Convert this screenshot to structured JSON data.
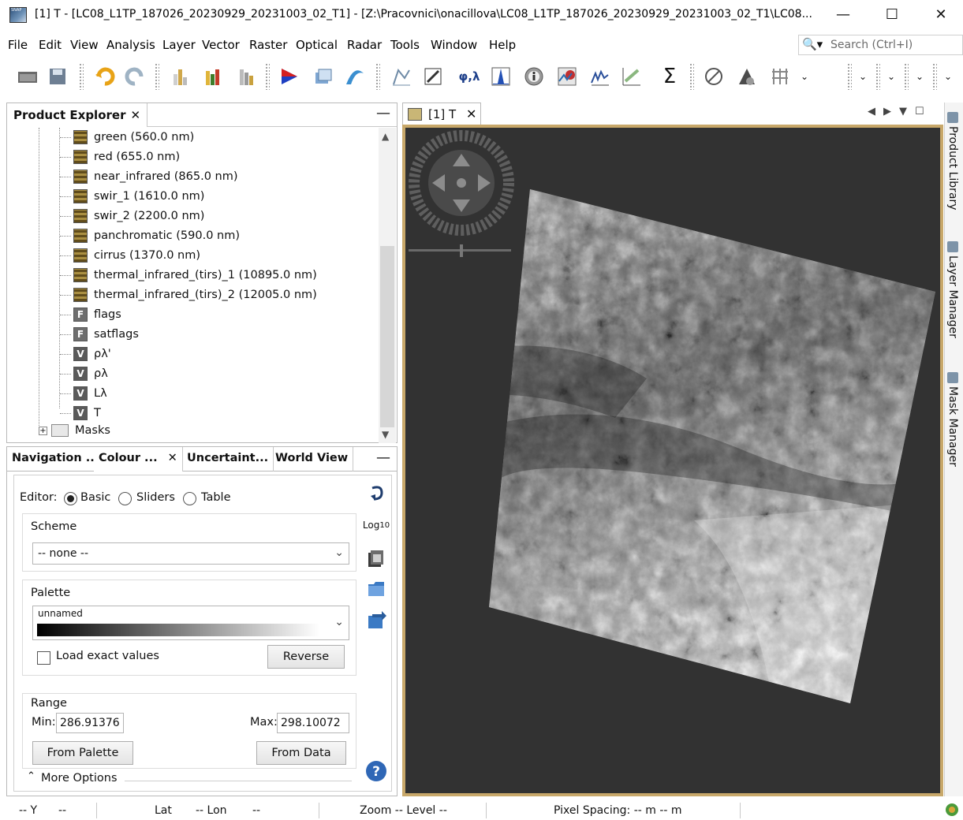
{
  "window": {
    "title": "[1] T - [LC08_L1TP_187026_20230929_20231003_02_T1] - [Z:\\Pracovnici\\onacillova\\LC08_L1TP_187026_20230929_20231003_02_T1\\LC08...",
    "minimize": "—",
    "maximize": "☐",
    "close": "✕"
  },
  "menu": [
    "File",
    "Edit",
    "View",
    "Analysis",
    "Layer",
    "Vector",
    "Raster",
    "Optical",
    "Radar",
    "Tools",
    "Window",
    "Help"
  ],
  "search": {
    "placeholder": "Search (Ctrl+I)",
    "icon": "search-icon"
  },
  "toolbar": {
    "phi_lambda": "φ,λ",
    "sigma": "Σ"
  },
  "product_explorer": {
    "title": "Product Explorer",
    "close": "✕",
    "minimize": "—",
    "nodes": [
      {
        "label": "green (560.0 nm)",
        "type": "band"
      },
      {
        "label": "red (655.0 nm)",
        "type": "band"
      },
      {
        "label": "near_infrared (865.0 nm)",
        "type": "band"
      },
      {
        "label": "swir_1 (1610.0 nm)",
        "type": "band"
      },
      {
        "label": "swir_2 (2200.0 nm)",
        "type": "band"
      },
      {
        "label": "panchromatic (590.0 nm)",
        "type": "band"
      },
      {
        "label": "cirrus (1370.0 nm)",
        "type": "band"
      },
      {
        "label": "thermal_infrared_(tirs)_1 (10895.0 nm)",
        "type": "band"
      },
      {
        "label": "thermal_infrared_(tirs)_2 (12005.0 nm)",
        "type": "band"
      },
      {
        "label": "flags",
        "type": "flag",
        "badge": "F"
      },
      {
        "label": "satflags",
        "type": "flag",
        "badge": "F"
      },
      {
        "label": "ρλ'",
        "type": "virtual",
        "badge": "V"
      },
      {
        "label": "ρλ",
        "type": "virtual",
        "badge": "V"
      },
      {
        "label": "Lλ",
        "type": "virtual",
        "badge": "V"
      },
      {
        "label": "T",
        "type": "virtual",
        "badge": "V"
      }
    ],
    "masks": "Masks",
    "expand": "+"
  },
  "tool_tabs": {
    "navigation": "Navigation ...",
    "colour": "Colour ...",
    "colour_close": "✕",
    "uncertainty": "Uncertaint...",
    "world_view": "World View",
    "minimize": "—"
  },
  "colour_manip": {
    "editor_label": "Editor:",
    "editor_options": [
      "Basic",
      "Sliders",
      "Table"
    ],
    "editor_selected": "Basic",
    "scheme_label": "Scheme",
    "scheme_value": "-- none --",
    "palette_label": "Palette",
    "palette_value": "unnamed",
    "load_exact": "Load exact values",
    "reverse": "Reverse",
    "range_label": "Range",
    "min_label": "Min:",
    "min_value": "286.91376",
    "max_label": "Max:",
    "max_value": "298.10072",
    "from_palette": "From Palette",
    "from_data": "From Data",
    "more_options": "More Options",
    "more_chevron": "⌃",
    "log_label": "Log",
    "log_sub": "10"
  },
  "image_view": {
    "tab_label": "[1] T",
    "tab_close": "✕"
  },
  "right_panel": {
    "tabs": [
      "Product Library",
      "Layer Manager",
      "Mask Manager"
    ]
  },
  "status": {
    "y": "-- Y",
    "y_val": "--",
    "lat": "Lat",
    "lon": "-- Lon",
    "lon_val": "--",
    "zoom": "Zoom -- Level --",
    "pixel_spacing": "Pixel Spacing: -- m -- m"
  },
  "colors": {
    "view_background": "#323232",
    "view_border": "#c8a86a",
    "accent": "#1f5fa8"
  }
}
